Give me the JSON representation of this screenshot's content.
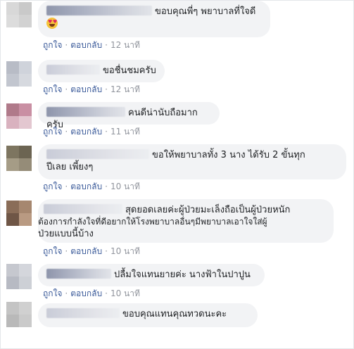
{
  "actions": {
    "like": "ถูกใจ",
    "reply": "ตอบกลับ",
    "separator": "·"
  },
  "comments": [
    {
      "text": "ขอบคุณพี่ๆ พยาบาลที่ใจดี",
      "line2": "",
      "emoji": "heart-eyes-emoji",
      "time": "12 นาที",
      "avatar": [
        "#d8d8d8",
        "#c9c9c9",
        "#dcdcdc",
        "#d2d2d2"
      ]
    },
    {
      "text": "ขอชื่นชมครับ",
      "line2": "",
      "time": "12 นาที",
      "avatar": [
        "#b8bcc6",
        "#cfd3db",
        "#c2c6cf",
        "#d6d9df"
      ]
    },
    {
      "text": "คนดีน่านับถือมากครับ",
      "line2": "",
      "time": "11 นาที",
      "avatar": [
        "#b07a8a",
        "#c98fa3",
        "#d9b2bf",
        "#e3c7d0"
      ]
    },
    {
      "text": "ขอให้พยาบาลทั้ง 3 นาง ได้รับ 2 ขั้นทุก",
      "line2": "ปีเลย เพี้ยงๆ",
      "time": "10 นาที",
      "avatar": [
        "#7d7560",
        "#6c6452",
        "#a59c86",
        "#958c78"
      ]
    },
    {
      "text": "สุดยอดเลยค่ะผู้ป่วยมะเล็งถือเป็นผู้ป่วยหนัก",
      "line2": "ต้องการกำลังใจที่ดีอยากให้โรงพยาบาลอื่นๆมีพยาบาลเอาใจใส่ผู้",
      "line3": "ป่วยแบบนี้บ้าง",
      "time": "10 นาที",
      "avatar": [
        "#8a6d58",
        "#a6876f",
        "#6f5646",
        "#b99a82"
      ]
    },
    {
      "text": "ปลื้มใจแทนยายค่ะ นางฟ้าในปาปูน",
      "line2": "",
      "time": "10 นาที",
      "avatar": [
        "#c6c8cf",
        "#d4d6dc",
        "#b7bac3",
        "#cdd0d6"
      ]
    },
    {
      "text": "ขอบคุณแทนคุณทวดนะคะ",
      "line2": "",
      "time": "",
      "avatar": [
        "#c4c4c4",
        "#d0d0d0",
        "#b9b9b9",
        "#cacaca"
      ]
    }
  ],
  "colors": {
    "bubble": "#f2f3f5",
    "link": "#385898",
    "meta": "#90949c",
    "text": "#1c1e21"
  }
}
